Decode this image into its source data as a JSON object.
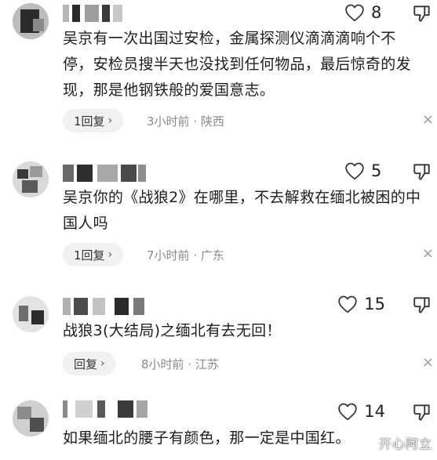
{
  "comments": [
    {
      "likes": "8",
      "text": "吴京有一次出国过安检，金属探测仪滴滴滴响个不停，安检员搜半天也没找到任何物品，最后惊奇的发现，那是他钢铁般的爱国意志。",
      "reply_label": "1回复",
      "time": "3小时前",
      "location": "陕西"
    },
    {
      "likes": "5",
      "text": "吴京你的《战狼2》在哪里，不去解救在缅北被困的中国人吗",
      "reply_label": "1回复",
      "time": "7小时前",
      "location": "广东"
    },
    {
      "likes": "15",
      "text": "战狼3(大结局)之缅北有去无回！",
      "reply_label": "回复",
      "time": "8小时前",
      "location": "江苏"
    },
    {
      "likes": "14",
      "text": "如果缅北的腰子有颜色，那一定是中国红。"
    }
  ],
  "separator": "·",
  "reply_chevron": "›",
  "close_glyph": "×",
  "watermark": "开心阿立",
  "icons": {
    "like": "heart-outline-icon",
    "dislike": "thumbs-down-icon",
    "close": "close-icon"
  },
  "colors": {
    "text": "#1d1d1d",
    "meta": "#8a8a8a",
    "reply_bg": "#f1f1f1"
  }
}
